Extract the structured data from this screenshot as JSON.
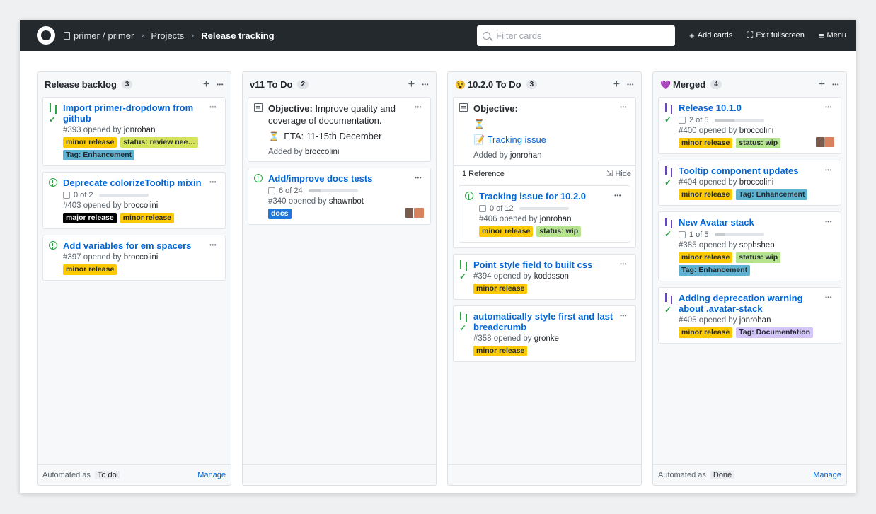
{
  "header": {
    "owner": "primer",
    "repo": "primer",
    "projects": "Projects",
    "board": "Release tracking",
    "filter_placeholder": "Filter cards",
    "add_cards": "Add cards",
    "exit_fullscreen": "Exit fullscreen",
    "menu": "Menu"
  },
  "colors": {
    "minor": "#fbca04",
    "review": "#d4e35a",
    "enhancement": "#5fb3d1",
    "major": "#000000",
    "wip": "#b5e38e",
    "docs": "#1d76db",
    "documentation": "#d4c5f9",
    "link": "#0366d6"
  },
  "columns": [
    {
      "name": "Release backlog",
      "count": "3",
      "automated_label": "Automated as",
      "automated_value": "To do",
      "manage": "Manage",
      "cards": [
        {
          "icon": "pr-green",
          "check": true,
          "title": "Import primer-dropdown from github",
          "number": "#393",
          "opened": "opened by",
          "user": "jonrohan",
          "labels": [
            "minor release",
            "status: review nee…",
            "Tag: Enhancement"
          ]
        },
        {
          "icon": "issue-open",
          "check": false,
          "title": "Deprecate colorizeTooltip mixin",
          "progress": "0 of 2",
          "progress_fraction": 0.0,
          "number": "#403",
          "opened": "opened by",
          "user": "broccolini",
          "labels": [
            "major release",
            "minor release"
          ]
        },
        {
          "icon": "issue-open",
          "check": false,
          "title": "Add variables for em spacers",
          "number": "#397",
          "opened": "opened by",
          "user": "broccolini",
          "labels": [
            "minor release"
          ]
        }
      ]
    },
    {
      "name": "v11 To Do",
      "count": "2",
      "note": {
        "heading": "Objective:",
        "body": "Improve quality and coverage of documentation.",
        "eta_emoji": "⏳",
        "eta": "ETA: 11-15th December",
        "added": "Added by",
        "user": "broccolini"
      },
      "cards": [
        {
          "icon": "issue-open",
          "title": "Add/improve docs tests",
          "progress": "6 of 24",
          "progress_fraction": 0.25,
          "number": "#340",
          "opened": "opened by",
          "user": "shawnbot",
          "labels": [
            "docs"
          ]
        }
      ]
    },
    {
      "name": "10.2.0 To Do",
      "emoji": "😵",
      "count": "3",
      "note": {
        "heading": "Objective:",
        "emoji": "⏳",
        "link_emoji": "📝",
        "link": "Tracking issue",
        "added": "Added by",
        "user": "jonrohan"
      },
      "reference": {
        "label": "1 Reference",
        "hide": "Hide"
      },
      "cards": [
        {
          "icon": "issue-open",
          "check": false,
          "title": "Tracking issue for 10.2.0",
          "progress": "0 of 12",
          "progress_fraction": 0.0,
          "number": "#406",
          "opened": "opened by",
          "user": "jonrohan",
          "labels": [
            "minor release",
            "status: wip"
          ]
        },
        {
          "icon": "pr-green",
          "check": true,
          "title": "Point style field to built css",
          "number": "#394",
          "opened": "opened by",
          "user": "koddsson",
          "labels": [
            "minor release"
          ]
        },
        {
          "icon": "pr-green",
          "check": true,
          "title": "automatically style first and last breadcrumb",
          "number": "#358",
          "opened": "opened by",
          "user": "gronke",
          "labels": [
            "minor release"
          ]
        }
      ]
    },
    {
      "name": "Merged",
      "emoji": "💜",
      "count": "4",
      "automated_label": "Automated as",
      "automated_value": "Done",
      "manage": "Manage",
      "cards": [
        {
          "icon": "pr-purple",
          "check": true,
          "title": "Release 10.1.0",
          "progress": "2 of 5",
          "progress_fraction": 0.4,
          "number": "#400",
          "opened": "opened by",
          "user": "broccolini",
          "labels": [
            "minor release",
            "status: wip"
          ]
        },
        {
          "icon": "pr-purple",
          "check": true,
          "title": "Tooltip component updates",
          "number": "#404",
          "opened": "opened by",
          "user": "broccolini",
          "labels": [
            "minor release",
            "Tag: Enhancement"
          ]
        },
        {
          "icon": "pr-purple",
          "check": true,
          "title": "New Avatar stack",
          "progress": "1 of 5",
          "progress_fraction": 0.2,
          "number": "#385",
          "opened": "opened by",
          "user": "sophshep",
          "labels": [
            "minor release",
            "status: wip",
            "Tag: Enhancement"
          ]
        },
        {
          "icon": "pr-purple",
          "check": true,
          "title": "Adding deprecation warning about .avatar-stack",
          "number": "#405",
          "opened": "opened by",
          "user": "jonrohan",
          "labels": [
            "minor release",
            "Tag: Documentation"
          ]
        }
      ]
    }
  ]
}
